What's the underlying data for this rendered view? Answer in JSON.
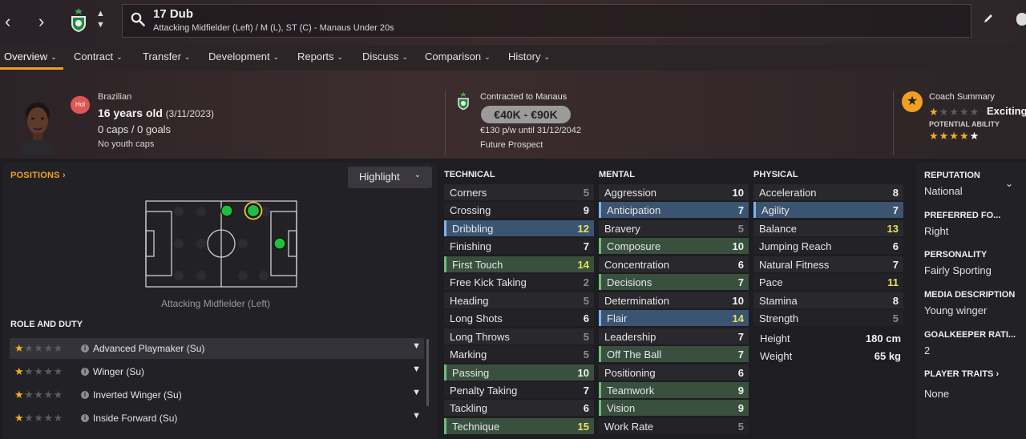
{
  "topbar": {
    "back_arrow": "‹",
    "forward_arrow": "›",
    "player_title": "17 Dub",
    "player_subtitle": "Attacking Midfielder (Left) / M (L), ST (C) - Manaus Under 20s"
  },
  "tabs": [
    {
      "label": "Overview"
    },
    {
      "label": "Contract"
    },
    {
      "label": "Transfer"
    },
    {
      "label": "Development"
    },
    {
      "label": "Reports"
    },
    {
      "label": "Discuss"
    },
    {
      "label": "Comparison"
    },
    {
      "label": "History"
    }
  ],
  "profile": {
    "position_badge": "Hol",
    "nationality": "Brazilian",
    "age": "16 years old",
    "dob": "(3/11/2023)",
    "caps": "0 caps / 0 goals",
    "youth_caps": "No youth caps"
  },
  "contract": {
    "club_line": "Contracted to Manaus",
    "value_range": "€40K - €90K",
    "wage": "€130 p/w until 31/12/2042",
    "status": "Future Prospect"
  },
  "coach": {
    "title": "Coach Summary",
    "rating_word": "Exciting",
    "current_ability_stars": 1,
    "potential_label": "POTENTIAL ABILITY",
    "potential_stars": 4.5
  },
  "positions": {
    "header": "POSITIONS",
    "highlight_label": "Highlight",
    "caption": "Attacking Midfielder (Left)"
  },
  "roles": {
    "header": "ROLE AND DUTY",
    "items": [
      {
        "name": "Advanced Playmaker (Su)",
        "stars": 1
      },
      {
        "name": "Winger (Su)",
        "stars": 1
      },
      {
        "name": "Inverted Winger (Su)",
        "stars": 1
      },
      {
        "name": "Inside Forward (Su)",
        "stars": 1
      }
    ]
  },
  "technical": {
    "header": "TECHNICAL",
    "rows": [
      {
        "name": "Corners",
        "value": "5"
      },
      {
        "name": "Crossing",
        "value": "9"
      },
      {
        "name": "Dribbling",
        "value": "12"
      },
      {
        "name": "Finishing",
        "value": "7"
      },
      {
        "name": "First Touch",
        "value": "14"
      },
      {
        "name": "Free Kick Taking",
        "value": "2"
      },
      {
        "name": "Heading",
        "value": "5"
      },
      {
        "name": "Long Shots",
        "value": "6"
      },
      {
        "name": "Long Throws",
        "value": "5"
      },
      {
        "name": "Marking",
        "value": "5"
      },
      {
        "name": "Passing",
        "value": "10"
      },
      {
        "name": "Penalty Taking",
        "value": "7"
      },
      {
        "name": "Tackling",
        "value": "6"
      },
      {
        "name": "Technique",
        "value": "15"
      }
    ]
  },
  "mental": {
    "header": "MENTAL",
    "rows": [
      {
        "name": "Aggression",
        "value": "10"
      },
      {
        "name": "Anticipation",
        "value": "7"
      },
      {
        "name": "Bravery",
        "value": "5"
      },
      {
        "name": "Composure",
        "value": "10"
      },
      {
        "name": "Concentration",
        "value": "6"
      },
      {
        "name": "Decisions",
        "value": "7"
      },
      {
        "name": "Determination",
        "value": "10"
      },
      {
        "name": "Flair",
        "value": "14"
      },
      {
        "name": "Leadership",
        "value": "7"
      },
      {
        "name": "Off The Ball",
        "value": "7"
      },
      {
        "name": "Positioning",
        "value": "6"
      },
      {
        "name": "Teamwork",
        "value": "9"
      },
      {
        "name": "Vision",
        "value": "9"
      },
      {
        "name": "Work Rate",
        "value": "5"
      }
    ]
  },
  "physical": {
    "header": "PHYSICAL",
    "rows": [
      {
        "name": "Acceleration",
        "value": "8"
      },
      {
        "name": "Agility",
        "value": "7"
      },
      {
        "name": "Balance",
        "value": "13"
      },
      {
        "name": "Jumping Reach",
        "value": "6"
      },
      {
        "name": "Natural Fitness",
        "value": "7"
      },
      {
        "name": "Pace",
        "value": "11"
      },
      {
        "name": "Stamina",
        "value": "8"
      },
      {
        "name": "Strength",
        "value": "5"
      }
    ],
    "height_label": "Height",
    "height_value": "180 cm",
    "weight_label": "Weight",
    "weight_value": "65 kg"
  },
  "info": {
    "reputation_label": "REPUTATION",
    "reputation_value": "National",
    "foot_label": "PREFERRED FO...",
    "foot_value": "Right",
    "personality_label": "PERSONALITY",
    "personality_value": "Fairly Sporting",
    "media_label": "MEDIA DESCRIPTION",
    "media_value": "Young winger",
    "gk_label": "GOALKEEPER RATI...",
    "gk_value": "2",
    "traits_label": "PLAYER TRAITS",
    "traits_value": "None"
  },
  "colors": {
    "accent": "#f0a020",
    "highlight_yellow": "#e8e35a",
    "row_blue": "#3b5471",
    "row_green": "#39503f",
    "dot_green": "#1fc040"
  }
}
